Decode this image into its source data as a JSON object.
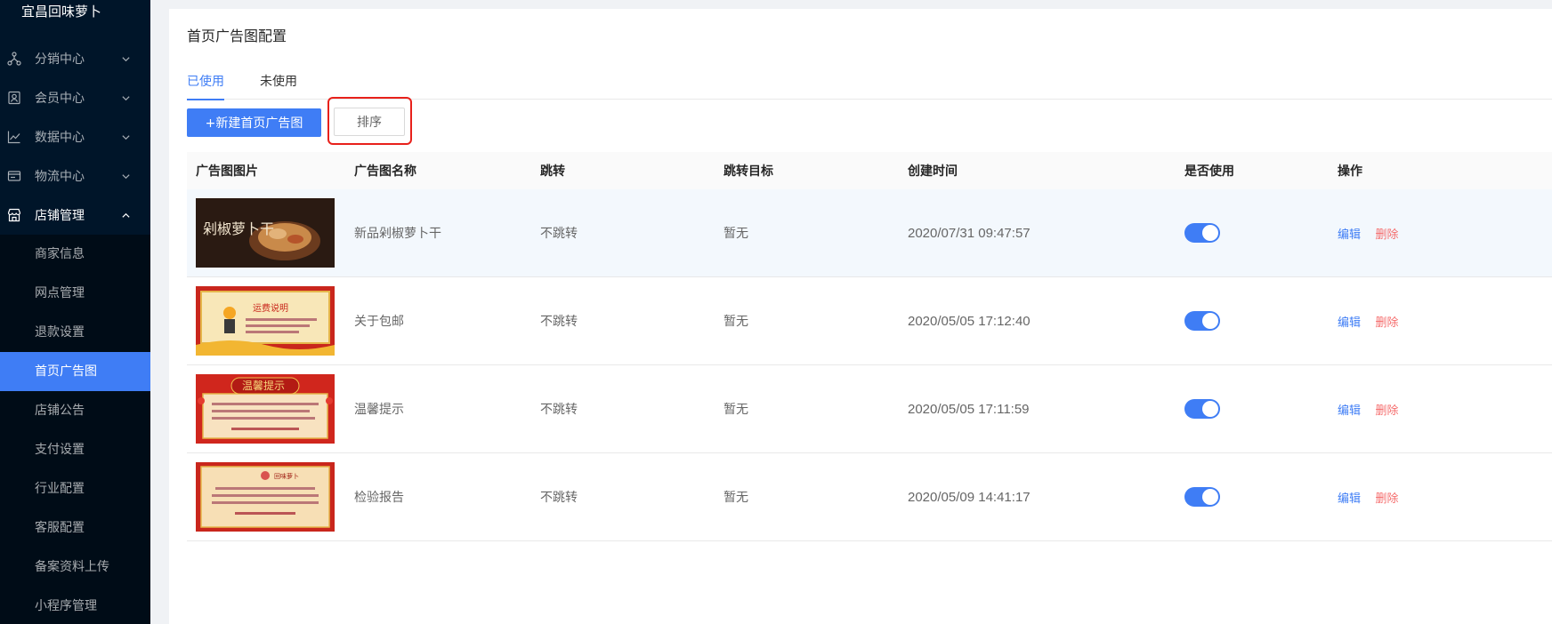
{
  "sidebar": {
    "brand": "宜昌回味萝卜",
    "groups": [
      {
        "label": "分销中心",
        "icon": "distribution-icon"
      },
      {
        "label": "会员中心",
        "icon": "member-icon"
      },
      {
        "label": "数据中心",
        "icon": "chart-icon"
      },
      {
        "label": "物流中心",
        "icon": "logistics-icon"
      },
      {
        "label": "店铺管理",
        "icon": "shop-icon"
      }
    ],
    "submenu": [
      "商家信息",
      "网点管理",
      "退款设置",
      "首页广告图",
      "店铺公告",
      "支付设置",
      "行业配置",
      "客服配置",
      "备案资料上传",
      "小程序管理"
    ],
    "active_sub": "首页广告图"
  },
  "page": {
    "title": "首页广告图配置",
    "tabs": [
      {
        "label": "已使用",
        "active": true
      },
      {
        "label": "未使用",
        "active": false
      }
    ],
    "new_button": "+新建首页广告图",
    "sort_button": "排序"
  },
  "table": {
    "headers": [
      "广告图图片",
      "广告图名称",
      "跳转",
      "跳转目标",
      "创建时间",
      "是否使用",
      "操作"
    ],
    "rows": [
      {
        "thumb_text": "剁椒萝卜干",
        "name": "新品剁椒萝卜干",
        "jump": "不跳转",
        "target": "暂无",
        "created": "2020/07/31 09:47:57",
        "enabled": true,
        "edit": "编辑",
        "delete": "删除"
      },
      {
        "thumb_text": "运费说明",
        "name": "关于包邮",
        "jump": "不跳转",
        "target": "暂无",
        "created": "2020/05/05 17:12:40",
        "enabled": true,
        "edit": "编辑",
        "delete": "删除"
      },
      {
        "thumb_text": "温馨提示",
        "name": "温馨提示",
        "jump": "不跳转",
        "target": "暂无",
        "created": "2020/05/05 17:11:59",
        "enabled": true,
        "edit": "编辑",
        "delete": "删除"
      },
      {
        "thumb_text": "回味萝卜",
        "name": "检验报告",
        "jump": "不跳转",
        "target": "暂无",
        "created": "2020/05/09 14:41:17",
        "enabled": true,
        "edit": "编辑",
        "delete": "删除"
      }
    ]
  },
  "colors": {
    "sidebar_bg": "#001529",
    "submenu_bg": "#000c17",
    "accent": "#3f7df5",
    "danger": "#f56c6c",
    "highlight_box": "#e8211b"
  }
}
